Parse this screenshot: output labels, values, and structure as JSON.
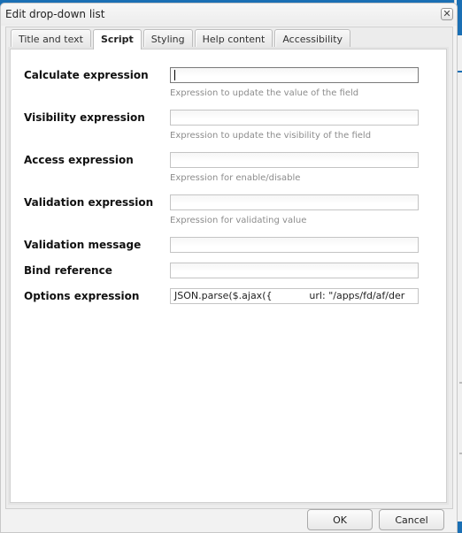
{
  "dialog": {
    "title": "Edit drop-down list",
    "close_icon": "close-icon"
  },
  "tabs": [
    {
      "label": "Title and text",
      "active": false
    },
    {
      "label": "Script",
      "active": true
    },
    {
      "label": "Styling",
      "active": false
    },
    {
      "label": "Help content",
      "active": false
    },
    {
      "label": "Accessibility",
      "active": false
    }
  ],
  "fields": {
    "calculate": {
      "label": "Calculate expression",
      "value": "",
      "help": "Expression to update the value of the field"
    },
    "visibility": {
      "label": "Visibility expression",
      "value": "",
      "help": "Expression to update the visibility of the field"
    },
    "access": {
      "label": "Access expression",
      "value": "",
      "help": "Expression for enable/disable"
    },
    "validation": {
      "label": "Validation expression",
      "value": "",
      "help": "Expression for validating value"
    },
    "validation_message": {
      "label": "Validation message",
      "value": ""
    },
    "bind_reference": {
      "label": "Bind reference",
      "value": ""
    },
    "options": {
      "label": "Options expression",
      "value": "JSON.parse($.ajax({            url: \"/apps/fd/af/der"
    }
  },
  "buttons": {
    "ok": "OK",
    "cancel": "Cancel"
  }
}
